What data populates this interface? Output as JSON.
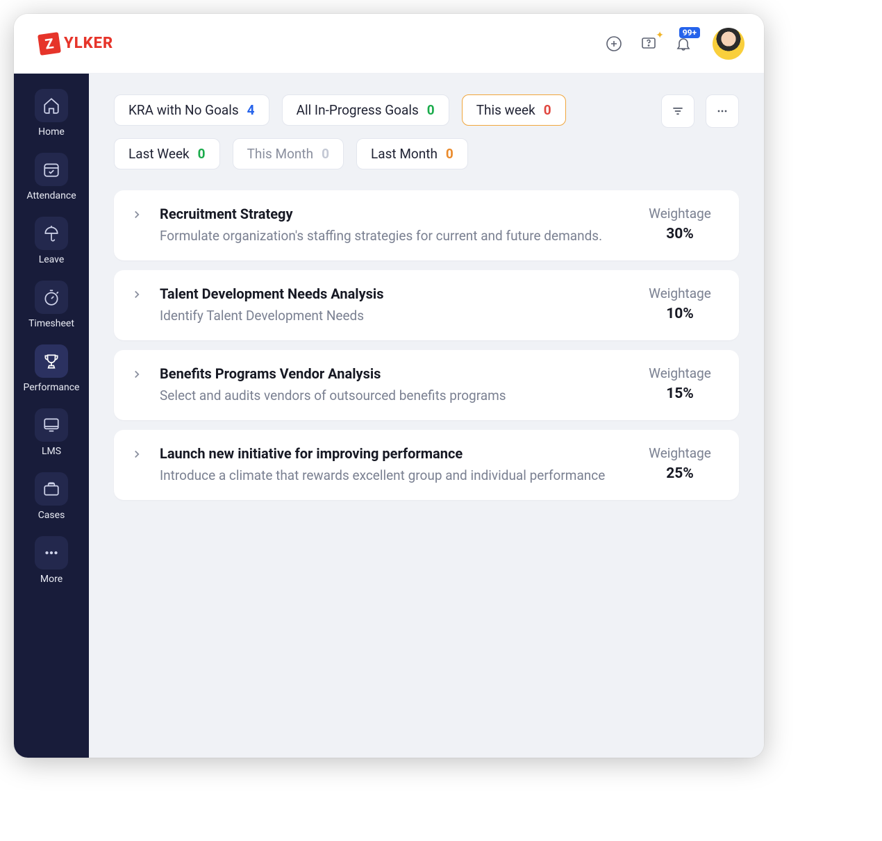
{
  "brand": {
    "mark": "Z",
    "name": "YLKER"
  },
  "header": {
    "notification_badge": "99+"
  },
  "sidebar": [
    {
      "label": "Home",
      "icon": "home",
      "active": false
    },
    {
      "label": "Attendance",
      "icon": "calendar",
      "active": false
    },
    {
      "label": "Leave",
      "icon": "umbrella",
      "active": false
    },
    {
      "label": "Timesheet",
      "icon": "stopwatch",
      "active": false
    },
    {
      "label": "Performance",
      "icon": "trophy",
      "active": true
    },
    {
      "label": "LMS",
      "icon": "screen",
      "active": false
    },
    {
      "label": "Cases",
      "icon": "briefcase",
      "active": false
    },
    {
      "label": "More",
      "icon": "dots",
      "active": false
    }
  ],
  "filters": [
    {
      "label": "KRA with No Goals",
      "count": "4",
      "countClass": "count-blue",
      "active": false
    },
    {
      "label": "All In-Progress Goals",
      "count": "0",
      "countClass": "count-green",
      "active": false
    },
    {
      "label": "This week",
      "count": "0",
      "countClass": "count-red",
      "active": true
    },
    {
      "label": "Last Week",
      "count": "0",
      "countClass": "count-green",
      "active": false
    },
    {
      "label": "This Month",
      "count": "0",
      "countClass": "count-blue",
      "active": false,
      "muted": true
    },
    {
      "label": "Last Month",
      "count": "0",
      "countClass": "count-orange",
      "active": false
    }
  ],
  "weightage_label": "Weightage",
  "kras": [
    {
      "title": "Recruitment Strategy",
      "desc": "Formulate organization's staffing strategies for current and future demands.",
      "weightage": "30%"
    },
    {
      "title": "Talent Development Needs Analysis",
      "desc": "Identify Talent Development Needs",
      "weightage": "10%"
    },
    {
      "title": "Benefits Programs Vendor Analysis",
      "desc": "Select and audits vendors of outsourced benefits programs",
      "weightage": "15%"
    },
    {
      "title": "Launch new initiative for improving performance",
      "desc": "Introduce a climate that rewards excellent group and individual performance",
      "weightage": "25%"
    }
  ]
}
